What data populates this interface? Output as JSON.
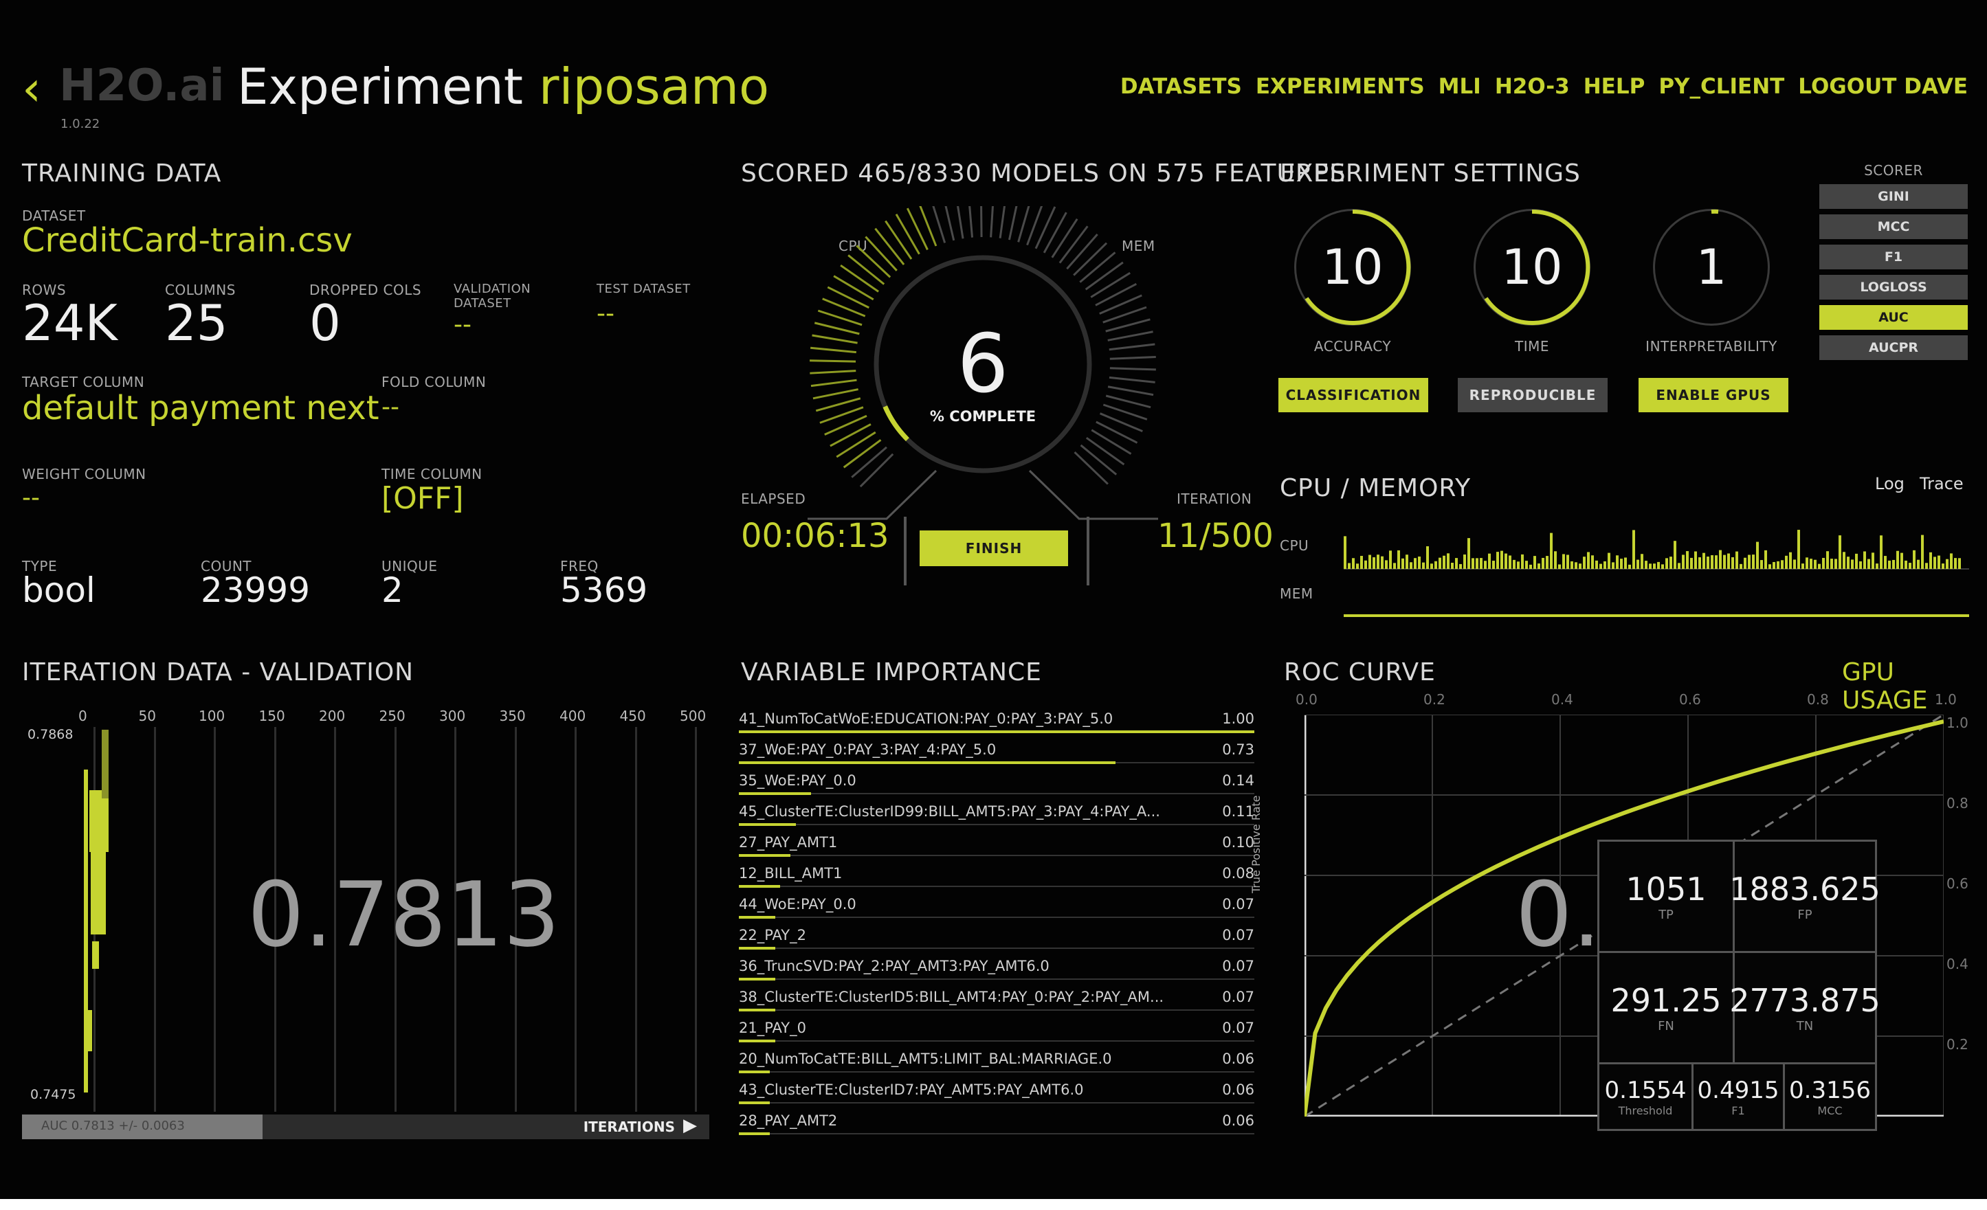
{
  "brand": {
    "back": "‹",
    "logo": "H2O.ai",
    "version": "1.0.22"
  },
  "title": {
    "prefix": "Experiment",
    "name": "riposamo"
  },
  "nav": [
    "DATASETS",
    "EXPERIMENTS",
    "MLI",
    "H2O-3",
    "HELP",
    "PY_CLIENT",
    "LOGOUT DAVE"
  ],
  "training": {
    "header": "TRAINING DATA",
    "dataset_label": "DATASET",
    "dataset": "CreditCard-train.csv",
    "rows_label": "ROWS",
    "rows": "24K",
    "columns_label": "COLUMNS",
    "columns": "25",
    "dropped_label": "DROPPED COLS",
    "dropped": "0",
    "validation_label_1": "VALIDATION",
    "validation_label_2": "DATASET",
    "validation": "--",
    "test_label": "TEST DATASET",
    "test": "--",
    "target_label": "TARGET COLUMN",
    "target": "default payment next",
    "fold_label": "FOLD COLUMN",
    "fold": "--",
    "weight_label": "WEIGHT COLUMN",
    "weight": "--",
    "time_label": "TIME COLUMN",
    "time": "[OFF]",
    "type_label": "TYPE",
    "type": "bool",
    "count_label": "COUNT",
    "count": "23999",
    "unique_label": "UNIQUE",
    "unique": "2",
    "freq_label": "FREQ",
    "freq": "5369"
  },
  "progress": {
    "header": "SCORED 465/8330 MODELS ON 575 FEATURES",
    "cpu_label": "CPU",
    "mem_label": "MEM",
    "value": "6",
    "value_label": "% COMPLETE",
    "percent": 6,
    "elapsed_label": "ELAPSED",
    "elapsed": "00:06:13",
    "iteration_label": "ITERATION",
    "iteration": "11/500",
    "finish": "FINISH"
  },
  "settings": {
    "header": "EXPERIMENT SETTINGS",
    "accuracy": "10",
    "accuracy_label": "ACCURACY",
    "time": "10",
    "time_label": "TIME",
    "interpretability": "1",
    "interpretability_label": "INTERPRETABILITY",
    "btn_classification": "CLASSIFICATION",
    "btn_reproducible": "REPRODUCIBLE",
    "btn_gpus": "ENABLE GPUS",
    "scorer_label": "SCORER",
    "scorers": [
      "GINI",
      "MCC",
      "F1",
      "LOGLOSS",
      "AUC",
      "AUCPR"
    ],
    "scorer_selected": "AUC"
  },
  "cpu_memory": {
    "header": "CPU / MEMORY",
    "log": "Log",
    "trace": "Trace",
    "cpu_label": "CPU",
    "mem_label": "MEM"
  },
  "iteration_data": {
    "header": "ITERATION DATA - VALIDATION",
    "x_ticks": [
      "0",
      "50",
      "100",
      "150",
      "200",
      "250",
      "300",
      "350",
      "400",
      "450",
      "500"
    ],
    "y_max": "0.7868",
    "y_min": "0.7475",
    "value": "0.7813",
    "footer_left": "AUC 0.7813 +/- 0.0063",
    "footer_right": "ITERATIONS"
  },
  "variable_importance": {
    "header": "VARIABLE IMPORTANCE",
    "rows": [
      {
        "name": "41_NumToCatWoE:EDUCATION:PAY_0:PAY_3:PAY_5.0",
        "value": "1.00",
        "bar": 1.0
      },
      {
        "name": "37_WoE:PAY_0:PAY_3:PAY_4:PAY_5.0",
        "value": "0.73",
        "bar": 0.73
      },
      {
        "name": "35_WoE:PAY_0.0",
        "value": "0.14",
        "bar": 0.14
      },
      {
        "name": "45_ClusterTE:ClusterID99:BILL_AMT5:PAY_3:PAY_4:PAY_A...",
        "value": "0.11",
        "bar": 0.11
      },
      {
        "name": "27_PAY_AMT1",
        "value": "0.10",
        "bar": 0.1
      },
      {
        "name": "12_BILL_AMT1",
        "value": "0.08",
        "bar": 0.08
      },
      {
        "name": "44_WoE:PAY_0.0",
        "value": "0.07",
        "bar": 0.07
      },
      {
        "name": "22_PAY_2",
        "value": "0.07",
        "bar": 0.07
      },
      {
        "name": "36_TruncSVD:PAY_2:PAY_AMT3:PAY_AMT6.0",
        "value": "0.07",
        "bar": 0.07
      },
      {
        "name": "38_ClusterTE:ClusterID5:BILL_AMT4:PAY_0:PAY_2:PAY_AM...",
        "value": "0.07",
        "bar": 0.07
      },
      {
        "name": "21_PAY_0",
        "value": "0.07",
        "bar": 0.07
      },
      {
        "name": "20_NumToCatTE:BILL_AMT5:LIMIT_BAL:MARRIAGE.0",
        "value": "0.06",
        "bar": 0.06
      },
      {
        "name": "43_ClusterTE:ClusterID7:PAY_AMT5:PAY_AMT6.0",
        "value": "0.06",
        "bar": 0.06
      },
      {
        "name": "28_PAY_AMT2",
        "value": "0.06",
        "bar": 0.06
      }
    ]
  },
  "roc": {
    "header": "ROC CURVE",
    "gpu": "GPU USAGE",
    "x_ticks": [
      "0.0",
      "0.2",
      "0.4",
      "0.6",
      "0.8",
      "1.0"
    ],
    "y_ticks": [
      "1.0",
      "0.8",
      "0.6",
      "0.4",
      "0.2"
    ],
    "ylabel": "True Positive Rate",
    "partial_value": "0.",
    "tp": "1051",
    "tp_label": "TP",
    "fp": "1883.625",
    "fp_label": "FP",
    "fn": "291.25",
    "fn_label": "FN",
    "tn": "2773.875",
    "tn_label": "TN",
    "threshold": "0.1554",
    "threshold_label": "Threshold",
    "f1": "0.4915",
    "f1_label": "F1",
    "mcc": "0.3156",
    "mcc_label": "MCC"
  },
  "colors": {
    "accent": "#c6d431",
    "background": "#030303",
    "muted": "#444444"
  }
}
